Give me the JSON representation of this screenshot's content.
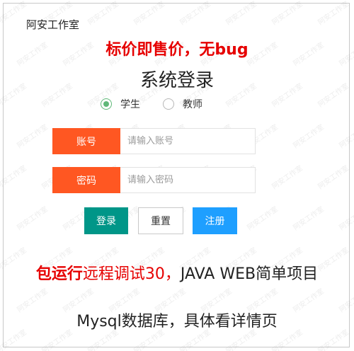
{
  "header": {
    "studio": "阿安工作室",
    "promo": "标价即售价，无bug",
    "title": "系统登录"
  },
  "roles": {
    "student": "学生",
    "teacher": "教师",
    "selected": "学生"
  },
  "form": {
    "account_label": "账号",
    "account_placeholder": "请输入账号",
    "password_label": "密码",
    "password_placeholder": "请输入密码"
  },
  "buttons": {
    "login": "登录",
    "reset": "重置",
    "register": "注册"
  },
  "footer": {
    "line1_bold": "包运行",
    "line1_red": "远程调试30，",
    "line1_rest": "JAVA WEB简单项目",
    "line2": "Mysql数据库，具体看详情页"
  },
  "watermark_text": "阿安工作室",
  "colors": {
    "promo_red": "#e60000",
    "label_orange": "#ff5722",
    "login_teal": "#009688",
    "register_blue": "#1e9fff",
    "radio_green": "#5fb878"
  }
}
